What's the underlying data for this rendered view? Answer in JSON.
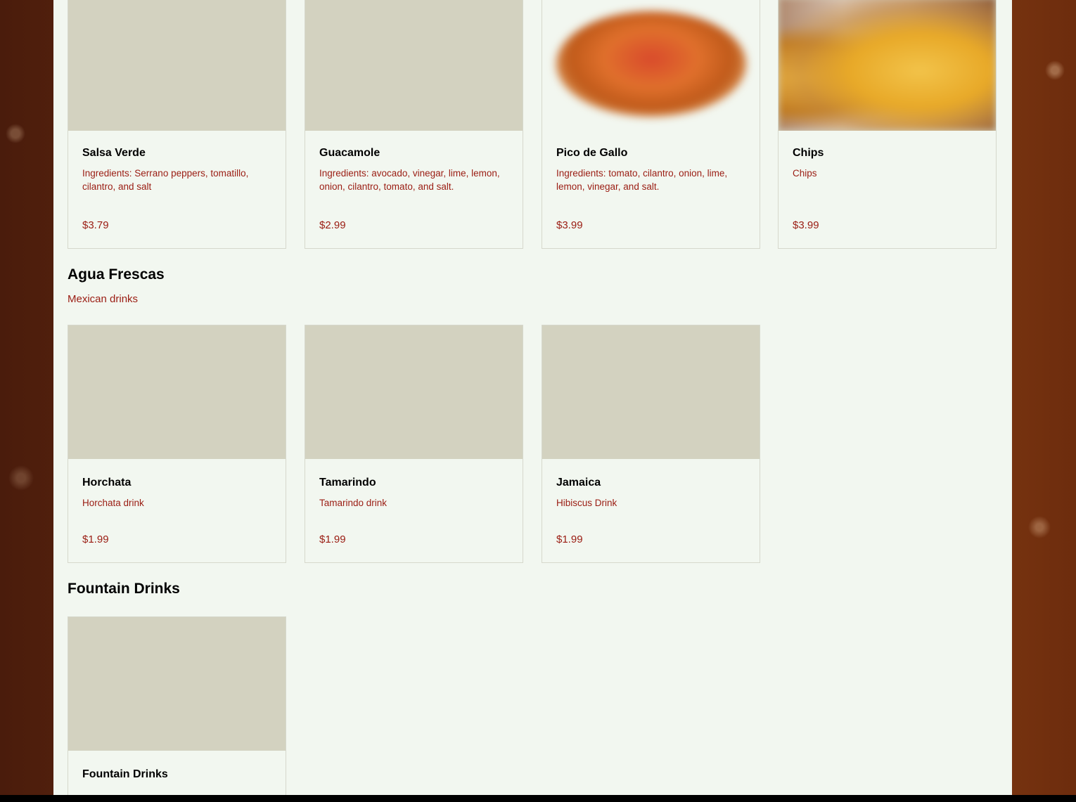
{
  "top_items": [
    {
      "name": "Salsa Verde",
      "desc": "Ingredients: Serrano peppers, tomatillo, cilantro, and salt",
      "price": "$3.79",
      "image": "placeholder"
    },
    {
      "name": "Guacamole",
      "desc": "Ingredients: avocado, vinegar, lime, lemon, onion, cilantro, tomato, and salt.",
      "price": "$2.99",
      "image": "placeholder"
    },
    {
      "name": "Pico de Gallo",
      "desc": "Ingredients: tomato, cilantro, onion, lime, lemon, vinegar, and salt.",
      "price": "$3.99",
      "image": "salsa-bowl"
    },
    {
      "name": "Chips",
      "desc": "Chips",
      "price": "$3.99",
      "image": "tortilla-chips"
    }
  ],
  "agua_frescas": {
    "title": "Agua Frescas",
    "subtitle": "Mexican drinks",
    "items": [
      {
        "name": "Horchata",
        "desc": "Horchata drink",
        "price": "$1.99"
      },
      {
        "name": "Tamarindo",
        "desc": "Tamarindo drink",
        "price": "$1.99"
      },
      {
        "name": "Jamaica",
        "desc": "Hibiscus Drink",
        "price": "$1.99"
      }
    ]
  },
  "fountain_drinks": {
    "title": "Fountain Drinks",
    "items": [
      {
        "name": "Fountain Drinks"
      }
    ]
  }
}
